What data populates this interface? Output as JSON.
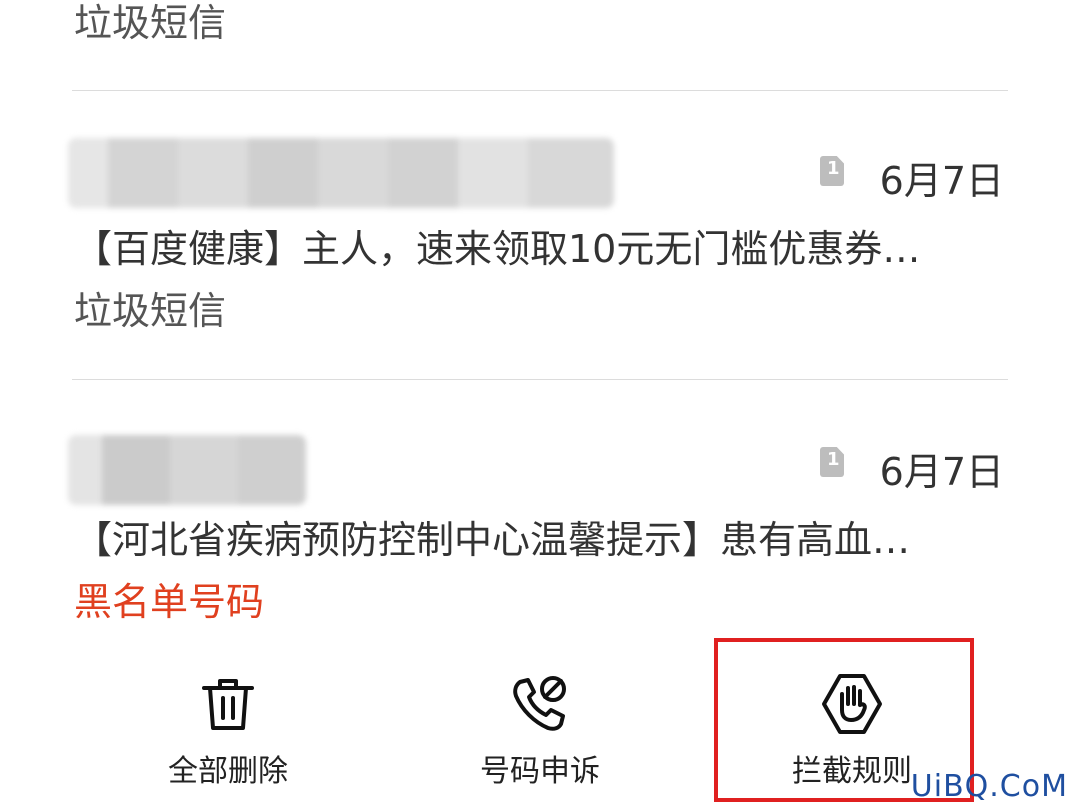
{
  "messages": [
    {
      "tag": "垃圾短信"
    },
    {
      "date": "6月7日",
      "preview": "【百度健康】主人，速来领取10元无门槛优惠券…",
      "tag": "垃圾短信"
    },
    {
      "date": "6月7日",
      "preview": "【河北省疾病预防控制中心温馨提示】患有高血…",
      "tag": "黑名单号码"
    }
  ],
  "toolbar": {
    "delete_all": "全部删除",
    "appeal": "号码申诉",
    "rules": "拦截规则"
  },
  "colors": {
    "blacklist": "#e0401f",
    "highlight": "#e02020"
  },
  "icons": [
    "sim-card-icon",
    "trash-icon",
    "phone-block-icon",
    "stop-hand-icon"
  ],
  "watermark": "UiBQ.CoM"
}
